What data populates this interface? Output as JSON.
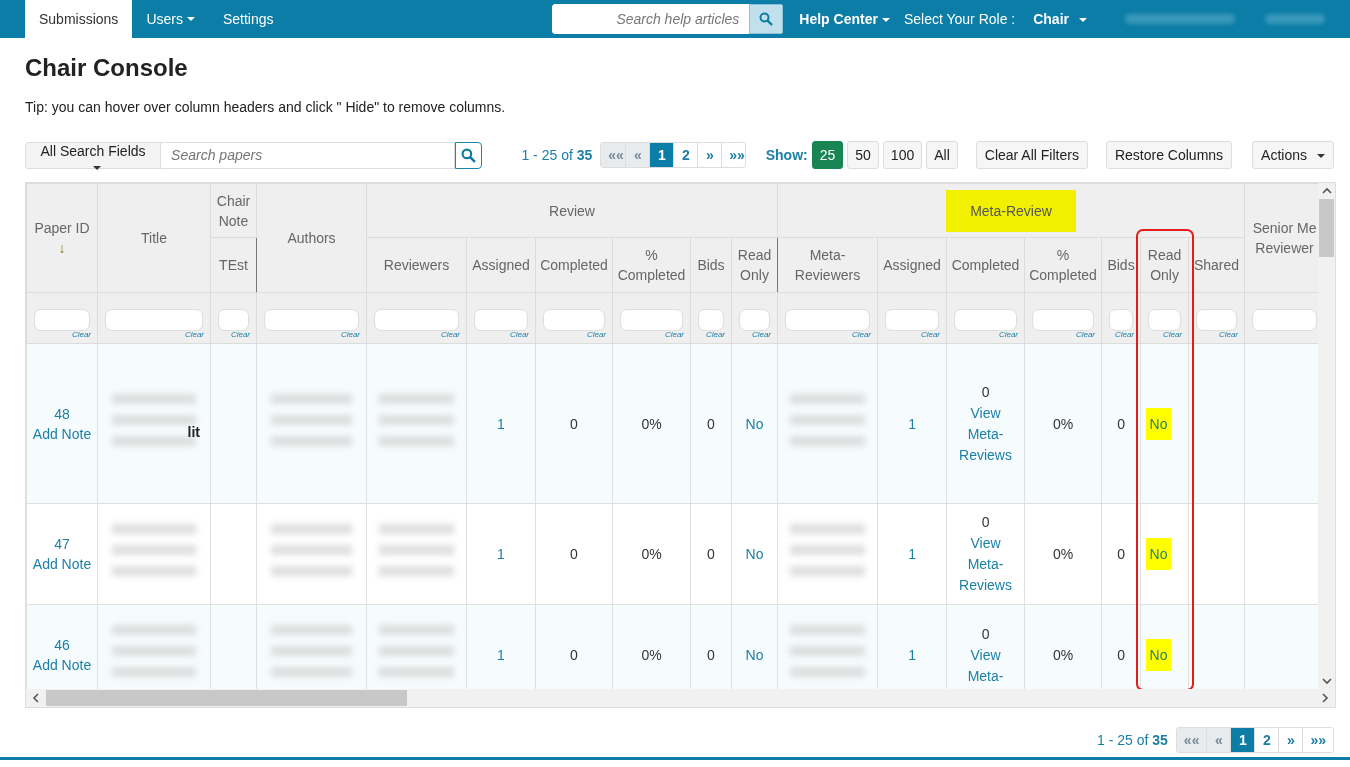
{
  "nav": {
    "tabs": [
      {
        "label": "Submissions",
        "selected": true,
        "has_caret": false
      },
      {
        "label": "Users",
        "selected": false,
        "has_caret": true
      },
      {
        "label": "Settings",
        "selected": false,
        "has_caret": false
      }
    ],
    "search": {
      "placeholder": "Search help articles"
    },
    "help_center": "Help Center",
    "role_label": "Select Your Role :",
    "role": "Chair"
  },
  "page": {
    "title": "Chair Console",
    "tip": "Tip: you can hover over column headers and click \" Hide\" to remove columns."
  },
  "toolbar": {
    "search_fields": "All Search Fields",
    "search": {
      "placeholder": "Search papers"
    },
    "range": "1 - 25 of **35**",
    "pagination": [
      {
        "label": "««",
        "selected": false
      },
      {
        "label": "«",
        "selected": false
      },
      {
        "label": "1",
        "selected": true
      },
      {
        "label": "2",
        "selected": false
      },
      {
        "label": "»",
        "selected": false
      },
      {
        "label": "»»",
        "selected": false
      }
    ],
    "show_label": "Show:",
    "page_sizes": [
      {
        "label": "25",
        "selected": true
      },
      {
        "label": "50",
        "selected": false
      },
      {
        "label": "100",
        "selected": false
      },
      {
        "label": "All",
        "selected": false
      }
    ],
    "buttons": [
      {
        "label": "Clear All Filters",
        "has_caret": false
      },
      {
        "label": "Restore Columns",
        "has_caret": false
      },
      {
        "label": "Actions",
        "has_caret": true
      }
    ]
  },
  "table": {
    "groups": [
      {
        "kind": "single",
        "label": "Paper ID",
        "sort_indicator": "↓",
        "clear": "Clear"
      },
      {
        "kind": "single",
        "label": "Title",
        "clear": "Clear"
      },
      {
        "kind": "group",
        "label": "Chair Note",
        "highlighted": false,
        "columns": [
          {
            "label": "TEst",
            "clear": "Clear",
            "framed": false
          }
        ]
      },
      {
        "kind": "single",
        "label": "Authors",
        "clear": "Clear"
      },
      {
        "kind": "group",
        "label": "Review",
        "highlighted": false,
        "columns": [
          {
            "label": "Reviewers",
            "clear": "Clear",
            "framed": false
          },
          {
            "label": "Assigned",
            "clear": "Clear",
            "framed": false
          },
          {
            "label": "Completed",
            "clear": "Clear",
            "framed": false
          },
          {
            "label": "% Completed",
            "clear": "Clear",
            "framed": false
          },
          {
            "label": "Bids",
            "clear": "Clear",
            "framed": false
          },
          {
            "label": "Read Only",
            "clear": "Clear",
            "framed": false
          }
        ]
      },
      {
        "kind": "group",
        "label": "Meta-Review",
        "highlighted": true,
        "columns": [
          {
            "label": "Meta-Reviewers",
            "clear": "Clear",
            "framed": false
          },
          {
            "label": "Assigned",
            "clear": "Clear",
            "framed": false
          },
          {
            "label": "Completed",
            "clear": "Clear",
            "framed": false
          },
          {
            "label": "% Completed",
            "clear": "Clear",
            "framed": false
          },
          {
            "label": "Bids",
            "clear": "Clear",
            "framed": false
          },
          {
            "label": "Read Only",
            "clear": "Clear",
            "framed": true
          },
          {
            "label": "Shared",
            "clear": "Clear",
            "framed": false
          }
        ]
      },
      {
        "kind": "single",
        "label": "Senior Me Reviewer"
      }
    ],
    "rows": [
      {
        "cells": [
          {
            "kind": "id",
            "text": "48",
            "link": "Add Note"
          },
          {
            "kind": "redacted",
            "fragment": "lit"
          },
          {
            "kind": "empty"
          },
          {
            "kind": "redacted"
          },
          {
            "kind": "redacted"
          },
          {
            "kind": "link",
            "text": "1"
          },
          {
            "kind": "number",
            "text": "0"
          },
          {
            "kind": "number",
            "text": "0%"
          },
          {
            "kind": "number",
            "text": "0"
          },
          {
            "kind": "link",
            "text": "No"
          },
          {
            "kind": "redacted"
          },
          {
            "kind": "link",
            "text": "1"
          },
          {
            "kind": "meta",
            "text": "0",
            "link": "View Meta-Reviews"
          },
          {
            "kind": "number",
            "text": "0%"
          },
          {
            "kind": "number",
            "text": "0"
          },
          {
            "kind": "flag",
            "text": "No",
            "highlighted": true
          },
          {
            "kind": "empty"
          },
          {
            "kind": "empty"
          }
        ]
      },
      {
        "cells": [
          {
            "kind": "id",
            "text": "47",
            "link": "Add Note"
          },
          {
            "kind": "redacted"
          },
          {
            "kind": "empty"
          },
          {
            "kind": "redacted"
          },
          {
            "kind": "redacted"
          },
          {
            "kind": "link",
            "text": "1"
          },
          {
            "kind": "number",
            "text": "0"
          },
          {
            "kind": "number",
            "text": "0%"
          },
          {
            "kind": "number",
            "text": "0"
          },
          {
            "kind": "link",
            "text": "No"
          },
          {
            "kind": "redacted"
          },
          {
            "kind": "link",
            "text": "1"
          },
          {
            "kind": "meta",
            "text": "0",
            "link": "View Meta-Reviews"
          },
          {
            "kind": "number",
            "text": "0%"
          },
          {
            "kind": "number",
            "text": "0"
          },
          {
            "kind": "flag",
            "text": "No",
            "highlighted": true
          },
          {
            "kind": "empty"
          },
          {
            "kind": "empty"
          }
        ]
      },
      {
        "cells": [
          {
            "kind": "id",
            "text": "46",
            "link": "Add Note"
          },
          {
            "kind": "redacted"
          },
          {
            "kind": "empty"
          },
          {
            "kind": "redacted"
          },
          {
            "kind": "redacted"
          },
          {
            "kind": "link",
            "text": "1"
          },
          {
            "kind": "number",
            "text": "0"
          },
          {
            "kind": "number",
            "text": "0%"
          },
          {
            "kind": "number",
            "text": "0"
          },
          {
            "kind": "link",
            "text": "No"
          },
          {
            "kind": "redacted"
          },
          {
            "kind": "link",
            "text": "1"
          },
          {
            "kind": "meta",
            "text": "0",
            "link": "View Meta-"
          },
          {
            "kind": "number",
            "text": "0%"
          },
          {
            "kind": "number",
            "text": "0"
          },
          {
            "kind": "flag",
            "text": "No",
            "highlighted": true
          },
          {
            "kind": "empty"
          },
          {
            "kind": "empty"
          }
        ]
      }
    ]
  },
  "footer": {
    "range": "1 - 25 of **35**",
    "pagination": [
      {
        "label": "««",
        "selected": false
      },
      {
        "label": "«",
        "selected": false
      },
      {
        "label": "1",
        "selected": true
      },
      {
        "label": "2",
        "selected": false
      },
      {
        "label": "»",
        "selected": false
      },
      {
        "label": "»»",
        "selected": false
      }
    ]
  }
}
